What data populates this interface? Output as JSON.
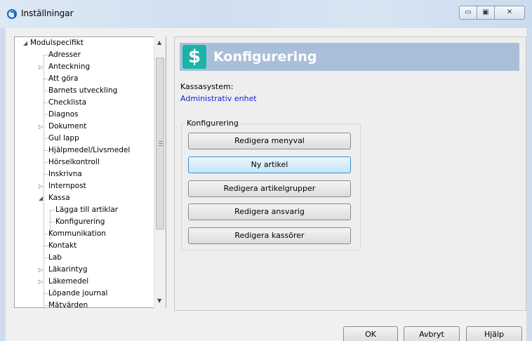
{
  "window": {
    "title": "Inställningar",
    "minimize_glyph": "▭",
    "maximize_glyph": "▣",
    "close_glyph": "✕"
  },
  "tree": {
    "items": [
      {
        "label": "Modulspecifikt",
        "level": 0,
        "state": "expanded"
      },
      {
        "label": "Adresser",
        "level": 1,
        "state": "leaf"
      },
      {
        "label": "Anteckning",
        "level": 1,
        "state": "collapsed"
      },
      {
        "label": "Att göra",
        "level": 1,
        "state": "leaf"
      },
      {
        "label": "Barnets utveckling",
        "level": 1,
        "state": "leaf"
      },
      {
        "label": "Checklista",
        "level": 1,
        "state": "leaf"
      },
      {
        "label": "Diagnos",
        "level": 1,
        "state": "leaf"
      },
      {
        "label": "Dokument",
        "level": 1,
        "state": "collapsed"
      },
      {
        "label": "Gul lapp",
        "level": 1,
        "state": "leaf"
      },
      {
        "label": "Hjälpmedel/Livsmedel",
        "level": 1,
        "state": "leaf"
      },
      {
        "label": "Hörselkontroll",
        "level": 1,
        "state": "leaf"
      },
      {
        "label": "Inskrivna",
        "level": 1,
        "state": "leaf"
      },
      {
        "label": "Internpost",
        "level": 1,
        "state": "collapsed"
      },
      {
        "label": "Kassa",
        "level": 1,
        "state": "expanded"
      },
      {
        "label": "Lägga till artiklar",
        "level": 2,
        "state": "leaf"
      },
      {
        "label": "Konfigurering",
        "level": 2,
        "state": "leaf"
      },
      {
        "label": "Kommunikation",
        "level": 1,
        "state": "leaf"
      },
      {
        "label": "Kontakt",
        "level": 1,
        "state": "leaf"
      },
      {
        "label": "Lab",
        "level": 1,
        "state": "leaf"
      },
      {
        "label": "Läkarintyg",
        "level": 1,
        "state": "collapsed"
      },
      {
        "label": "Läkemedel",
        "level": 1,
        "state": "collapsed"
      },
      {
        "label": "Löpande journal",
        "level": 1,
        "state": "leaf"
      },
      {
        "label": "Mätvärden",
        "level": 1,
        "state": "leaf"
      }
    ]
  },
  "scrollbar": {
    "up_glyph": "▲",
    "down_glyph": "▼"
  },
  "main": {
    "icon_glyph": "$",
    "header_title": "Konfigurering",
    "kassasystem_label": "Kassasystem:",
    "kassasystem_value": "Administrativ enhet",
    "group_title": "Konfigurering",
    "buttons": [
      "Redigera menyval",
      "Ny artikel",
      "Redigera artikelgrupper",
      "Redigera ansvarig",
      "Redigera kassörer"
    ]
  },
  "footer": {
    "ok": "OK",
    "cancel": "Avbryt",
    "help": "Hjälp"
  },
  "colors": {
    "header_bg": "#a9bfd9",
    "icon_bg": "#1bb3a8",
    "link": "#1a1adb"
  }
}
